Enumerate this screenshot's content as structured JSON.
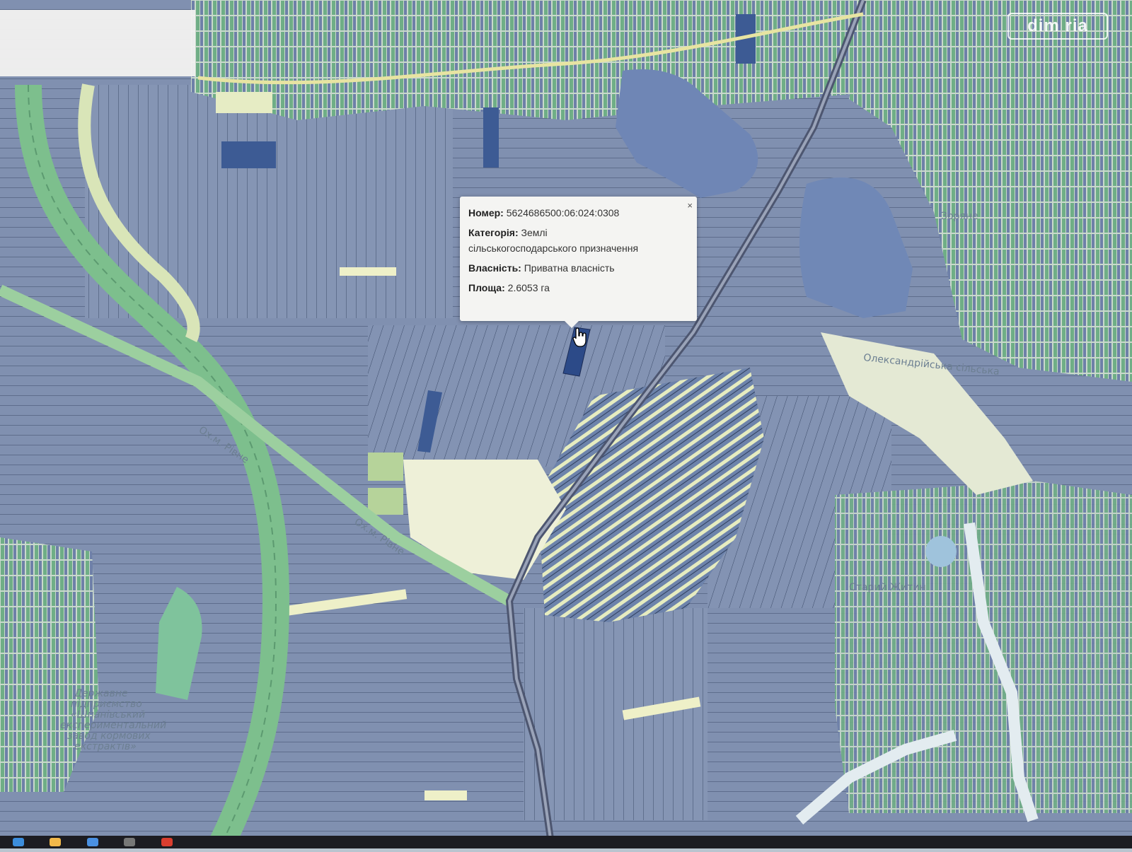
{
  "popup": {
    "number_label": "Номер:",
    "number_value": "5624686500:06:024:0308",
    "category_label": "Категорія:",
    "category_value_line1": "Землі",
    "category_value_line2": "сільськогосподарського призначення",
    "ownership_label": "Власність:",
    "ownership_value": "Приватна власність",
    "area_label": "Площа:",
    "area_value": "2.6053 га",
    "close_symbol": "×"
  },
  "watermark": {
    "text": "dim ria"
  },
  "map_labels": {
    "road_label_1": "Ох.м. Рівне",
    "road_label_2": "Ох.м. Рівне",
    "village_1": "Олександрійська сільська",
    "village_2": "Старий Житин",
    "village_3": "Зоряне",
    "org_line1": "Державне",
    "org_line2": "підприємство",
    "org_line3": "«Шпанівський",
    "org_line4": "експериментальний",
    "org_line5": "завод кормових",
    "org_line6": "екстрактів»"
  },
  "colors": {
    "parcel_blue": "#8494b4",
    "parcel_dark": "#3d5b94",
    "parcel_green": "#79b48a",
    "road_green": "#7dbf8d",
    "parcel_yellow": "#e9edc5",
    "water": "#6f86b5"
  }
}
